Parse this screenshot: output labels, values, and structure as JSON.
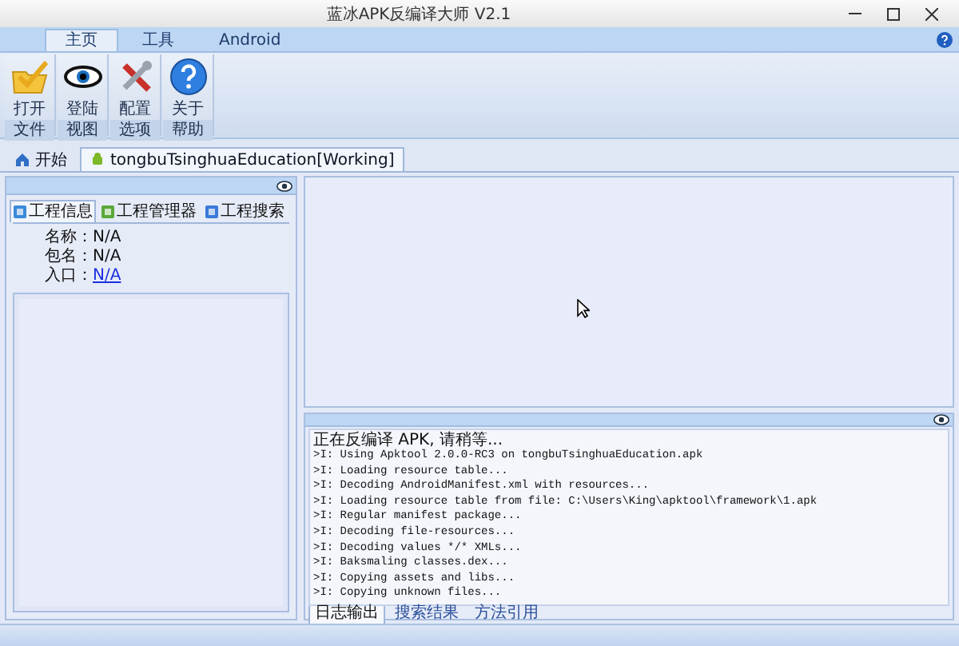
{
  "window": {
    "title": "蓝冰APK反编译大师 V2.1"
  },
  "ribbon": {
    "tabs": [
      {
        "label": "主页",
        "selected": true
      },
      {
        "label": "工具",
        "selected": false
      },
      {
        "label": "Android",
        "selected": false
      }
    ],
    "groups": [
      {
        "label": "文件",
        "buttons": [
          {
            "label": "打开",
            "kind": "open"
          }
        ]
      },
      {
        "label": "视图",
        "buttons": [
          {
            "label": "登陆",
            "kind": "view"
          }
        ]
      },
      {
        "label": "选项",
        "buttons": [
          {
            "label": "配置",
            "kind": "config"
          }
        ]
      },
      {
        "label": "帮助",
        "buttons": [
          {
            "label": "关于",
            "kind": "about"
          }
        ]
      }
    ]
  },
  "doc_tabs": [
    {
      "label": "开始",
      "kind": "home",
      "selected": false
    },
    {
      "label": "tongbuTsinghuaEducation[Working]",
      "kind": "android",
      "selected": true
    }
  ],
  "project_panel": {
    "tabs": [
      {
        "label": "工程信息",
        "kind": "info",
        "selected": true
      },
      {
        "label": "工程管理器",
        "kind": "manager",
        "selected": false
      },
      {
        "label": "工程搜索",
        "kind": "search",
        "selected": false
      }
    ],
    "fields": [
      {
        "label": "名称：",
        "value": "N/A",
        "kind": "text"
      },
      {
        "label": "包名：",
        "value": "N/A",
        "kind": "text"
      },
      {
        "label": "入口：",
        "value": "N/A",
        "kind": "link"
      }
    ]
  },
  "log_panel": {
    "lines": [
      "正在反编译 APK, 请稍等...",
      ">I: Using Apktool 2.0.0-RC3 on tongbuTsinghuaEducation.apk",
      ">I: Loading resource table...",
      ">I: Decoding AndroidManifest.xml with resources...",
      ">I: Loading resource table from file: C:\\Users\\King\\apktool\\framework\\1.apk",
      ">I: Regular manifest package...",
      ">I: Decoding file-resources...",
      ">I: Decoding values */* XMLs...",
      ">I: Baksmaling classes.dex...",
      ">I: Copying assets and libs...",
      ">I: Copying unknown files..."
    ],
    "tabs": [
      {
        "label": "日志输出",
        "selected": true
      },
      {
        "label": "搜索结果",
        "selected": false
      },
      {
        "label": "方法引用",
        "selected": false
      }
    ]
  }
}
